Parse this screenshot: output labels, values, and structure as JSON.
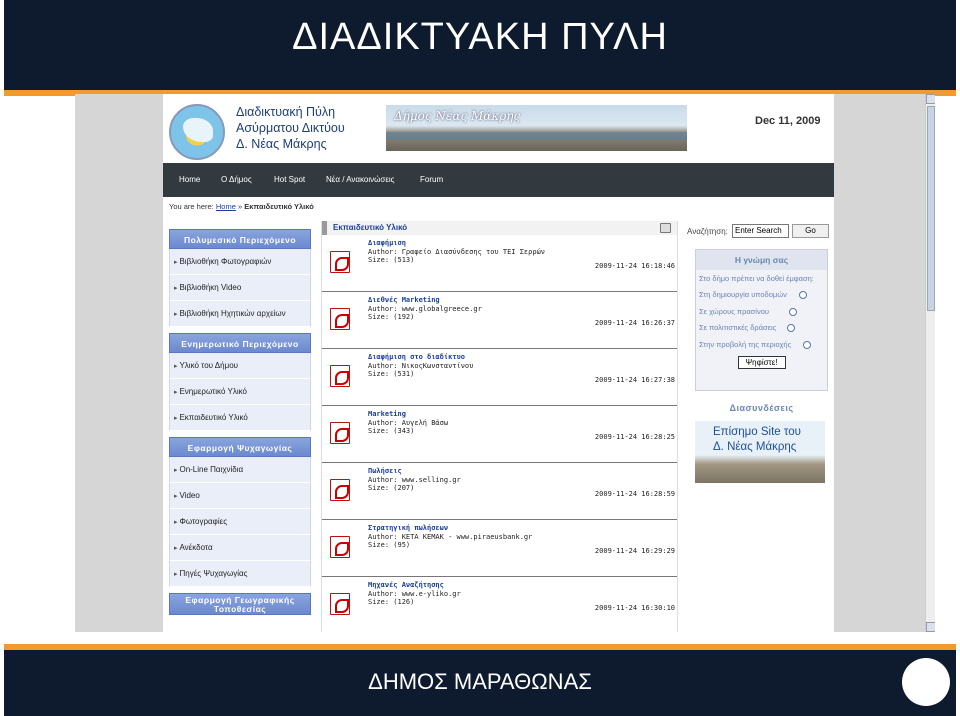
{
  "slide": {
    "title": "ΔΙΑΔΙΚΤΥΑΚΗ ΠΥΛΗ",
    "footer": "ΔΗΜΟΣ ΜΑΡΑΘΩΝΑΣ"
  },
  "colors": {
    "slide_bg": "#0e1a2e",
    "accent_bar": "#f29a2e",
    "nav_bg": "#333a3f",
    "menu_header": "#7a96d6"
  },
  "site": {
    "name_lines": [
      "Διαδικτυακή Πύλη",
      "Ασύρματου Δικτύου",
      "Δ. Νέας Μάκρης"
    ],
    "banner_text": "Δήμος Νέας Μάκρης",
    "date": "Dec 11, 2009",
    "nav": [
      "Home",
      "Ο Δήμος",
      "Hot Spot",
      "Νέα / Ανακοινώσεις",
      "Forum"
    ],
    "breadcrumb": {
      "prefix": "You are here:",
      "home": "Home",
      "sep": "»",
      "current": "Εκπαιδευτικό Υλικό"
    }
  },
  "left_menu": [
    {
      "header": "Πολυμεσικό Περιεχόμενο",
      "items": [
        "Βιβλιοθήκη Φωτογραφιών",
        "Βιβλιοθήκη Video",
        "Βιβλιοθήκη Ηχητικών αρχείων"
      ]
    },
    {
      "header": "Ενημερωτικό Περιεχόμενο",
      "items": [
        "Υλικό του Δήμου",
        "Ενημερωτικό Υλικό",
        "Εκπαιδευτικό Υλικό"
      ]
    },
    {
      "header": "Εφαρμογή Ψυχαγωγίας",
      "items": [
        "On-Line Παιχνίδια",
        "Video",
        "Φωτογραφίες",
        "Ανέκδοτα",
        "Πηγές Ψυχαγωγίας"
      ]
    },
    {
      "header": "Εφαρμογή Γεωγραφικής Τοποθεσίας",
      "items": []
    }
  ],
  "content": {
    "title": "Εκπαιδευτικό Υλικό",
    "items": [
      {
        "title": "Διαφήμιση",
        "author": "Author: Γραφείο Διασύνδεσης του ΤΕΙ Σερρών",
        "size": "Size: (513)",
        "date": "2009-11-24 16:18:46"
      },
      {
        "title": "Διεθνές Marketing",
        "author": "Author: www.globalgreece.gr",
        "size": "Size: (192)",
        "date": "2009-11-24 16:26:37"
      },
      {
        "title": "Διαφήμιση στο διαδίκτυο",
        "author": "Author: ΝικοςΚωνσταντίνου",
        "size": "Size: (531)",
        "date": "2009-11-24 16:27:38"
      },
      {
        "title": "Marketing",
        "author": "Author: Αυγελή Βάσω",
        "size": "Size: (343)",
        "date": "2009-11-24 16:28:25"
      },
      {
        "title": "Πωλήσεις",
        "author": "Author: www.selling.gr",
        "size": "Size: (207)",
        "date": "2009-11-24 16:28:59"
      },
      {
        "title": "Στρατηγική πωλήσεων",
        "author": "Author: ΚΕΤΑ ΚΕΜΑΚ - www.piraeusbank.gr",
        "size": "Size: (95)",
        "date": "2009-11-24 16:29:29"
      },
      {
        "title": "Μηχανές Αναζήτησης",
        "author": "Author: www.e-yliko.gr",
        "size": "Size: (126)",
        "date": "2009-11-24 16:30:10"
      }
    ]
  },
  "search": {
    "label": "Αναζήτηση:",
    "value": "Enter Search",
    "button": "Go"
  },
  "poll": {
    "title": "Η γνώμη σας",
    "question": "Στο δήμο πρέπει να δοθεί έμφαση:",
    "options": [
      "Στη δημιουργία υποδομών",
      "Σε χώρους πρασίνου",
      "Σε πολιτιστικές δράσεις",
      "Στην προβολή της περιοχής"
    ],
    "vote": "Ψηφίστε!"
  },
  "links": {
    "title": "Διασυνδέσεις",
    "banner": [
      "Επίσημο Site του",
      "Δ. Νέας Μάκρης"
    ]
  }
}
